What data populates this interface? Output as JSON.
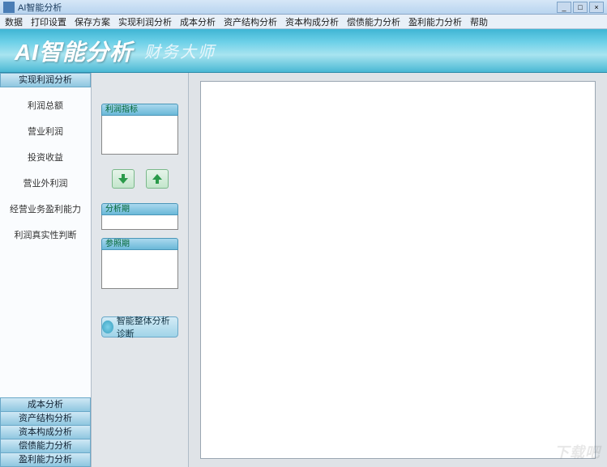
{
  "window": {
    "title": "AI智能分析"
  },
  "menu": [
    "数据",
    "打印设置",
    "保存方案",
    "实现利润分析",
    "成本分析",
    "资产结构分析",
    "资本构成分析",
    "偿债能力分析",
    "盈利能力分析",
    "帮助"
  ],
  "banner": {
    "logo": "AI智能分析",
    "subtitle": "财务大师"
  },
  "sidebar": {
    "active_header": "实现利润分析",
    "items": [
      "利润总额",
      "营业利润",
      "投资收益",
      "营业外利润",
      "经营业务盈利能力",
      "利润真实性判断"
    ],
    "stack": [
      "成本分析",
      "资产结构分析",
      "资本构成分析",
      "偿债能力分析",
      "盈利能力分析"
    ]
  },
  "mid": {
    "group1": "利润指标",
    "group2": "分析期",
    "group3": "参照期",
    "analyze_btn": "智能整体分析诊断"
  },
  "watermark": "下载吧"
}
